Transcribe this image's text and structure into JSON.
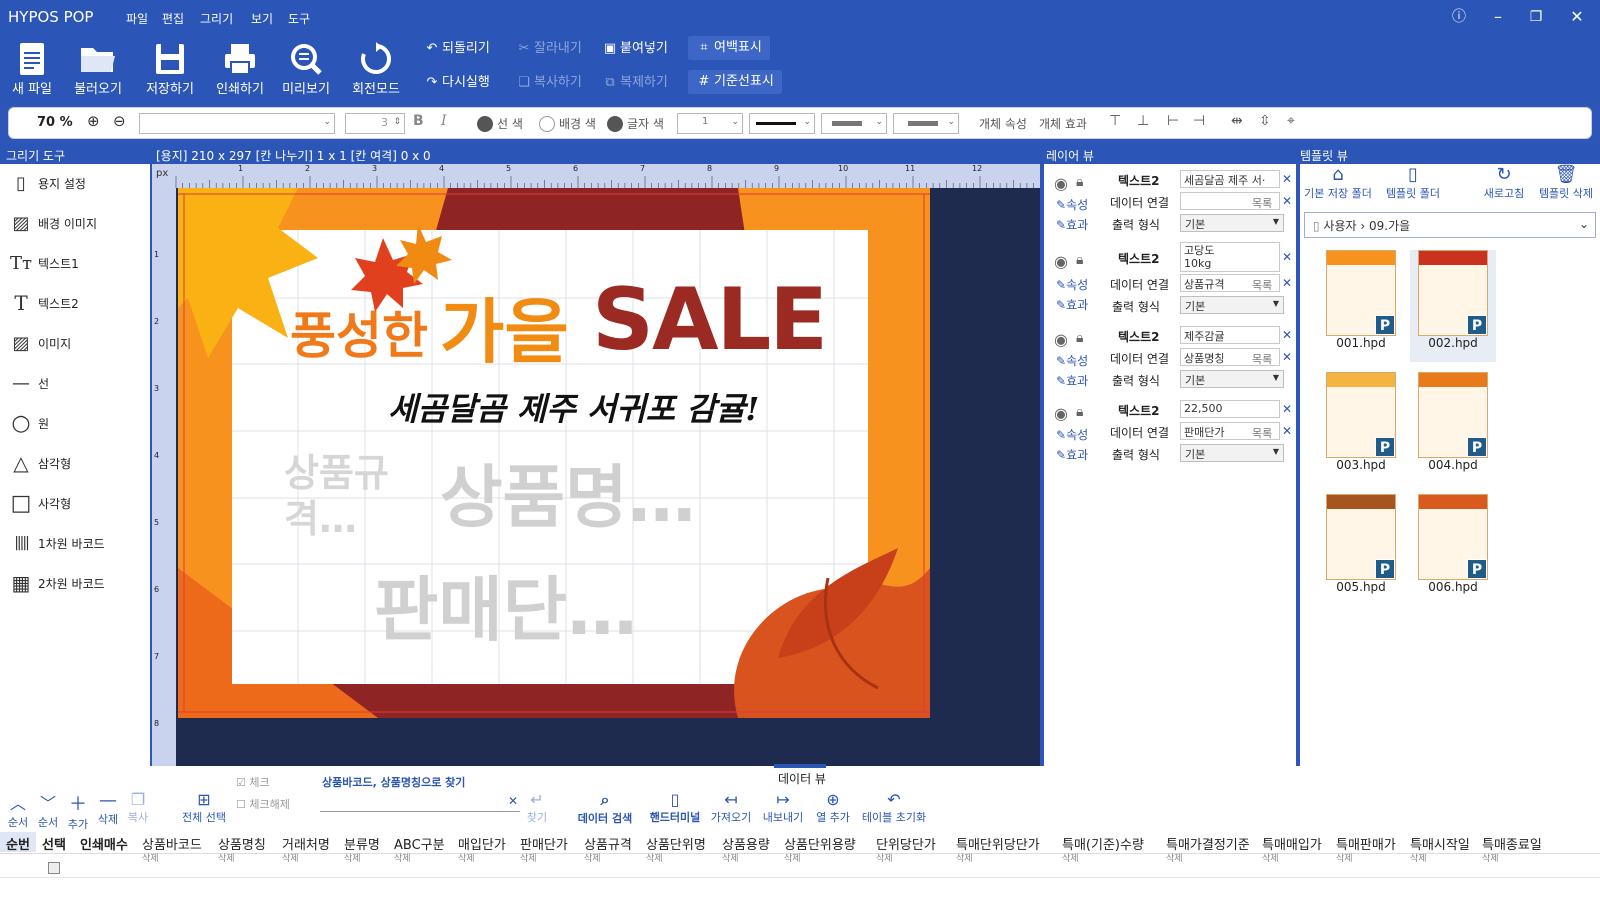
{
  "app": {
    "title": "HYPOS POP",
    "menus": [
      "파일",
      "편집",
      "그리기",
      "보기",
      "도구"
    ]
  },
  "ribbon": {
    "big": [
      {
        "label": "새 파일",
        "icon": "new-file-icon"
      },
      {
        "label": "불러오기",
        "icon": "folder-open-icon"
      },
      {
        "label": "저장하기",
        "icon": "save-icon"
      },
      {
        "label": "인쇄하기",
        "icon": "print-icon"
      },
      {
        "label": "미리보기",
        "icon": "preview-icon"
      },
      {
        "label": "회전모드",
        "icon": "rotate-icon"
      }
    ],
    "undo": "되돌리기",
    "redo": "다시실행",
    "cut": "잘라내기",
    "copy": "복사하기",
    "paste": "붙여넣기",
    "duplicate": "복제하기",
    "margin": "여백표시",
    "guides": "기준선표시"
  },
  "toolbar": {
    "zoom": "70 %",
    "font_size": "3",
    "line_color": "선 색",
    "bg_color": "배경 색",
    "text_color": "글자 색",
    "line_width": "1",
    "obj_props": "개체 속성",
    "obj_effect": "개체 효과"
  },
  "headers": {
    "tools": "그리기 도구",
    "paper": "[용지] 210 x 297  [칸 나누기] 1 x 1  [칸 여격] 0 x 0",
    "layer": "레이어 뷰",
    "template": "템플릿 뷰"
  },
  "tools": [
    "용지 설정",
    "배경 이미지",
    "텍스트1",
    "텍스트2",
    "이미지",
    "선",
    "원",
    "삼각형",
    "사각형",
    "1차원 바코드",
    "2차원 바코드"
  ],
  "ruler": {
    "unit": "px",
    "top": [
      "1",
      "2",
      "3",
      "4",
      "5",
      "6",
      "7",
      "8",
      "9",
      "10",
      "11",
      "12"
    ],
    "left": [
      "1",
      "2",
      "3",
      "4",
      "5",
      "6",
      "7",
      "8"
    ]
  },
  "poster": {
    "headline_a": "풍성한",
    "headline_b": "가을",
    "headline_c": "SALE",
    "subtitle": "세곰달곰 제주 서귀포 감귤!",
    "spec": "상품규격…",
    "name": "상품명…",
    "price": "판매단…"
  },
  "layers": [
    {
      "title": "텍스트2",
      "value": "세곰달곰 제주 서·",
      "link": "",
      "list": "목록",
      "format": "기본"
    },
    {
      "title": "텍스트2",
      "value": "고당도\n10kg",
      "link": "상품규격",
      "list": "목록",
      "format": "기본"
    },
    {
      "title": "텍스트2",
      "value": "제주감귤",
      "link": "상품명칭",
      "list": "목록",
      "format": "기본"
    },
    {
      "title": "텍스트2",
      "value": "22,500",
      "link": "판매단가",
      "list": "목록",
      "format": "기본"
    }
  ],
  "layer_labels": {
    "prop": "속성",
    "effect": "효과",
    "data_link": "데이터 연결",
    "out_format": "출력 형식"
  },
  "template": {
    "actions": [
      "기본 저장 폴더",
      "템플릿 폴더",
      "새로고침",
      "템플릿 삭제"
    ],
    "path_root": "사용자",
    "path_folder": "09.가을",
    "files": [
      "001.hpd",
      "002.hpd",
      "003.hpd",
      "004.hpd",
      "005.hpd",
      "006.hpd"
    ]
  },
  "dataview": {
    "title": "데이터 뷰",
    "buttons": [
      "순서",
      "순서",
      "추가",
      "삭제",
      "복사",
      "전체 선택",
      "체크",
      "체크해제",
      "찾기",
      "데이터 검색",
      "핸드터미널",
      "가져오기",
      "내보내기",
      "열 추가",
      "테이블 초기화"
    ],
    "search_placeholder": "상품바코드, 상품명칭으로 찾기",
    "columns": [
      "순번",
      "선택",
      "인쇄매수",
      "상품바코드",
      "상품명칭",
      "거래처명",
      "분류명",
      "ABC구분",
      "매입단가",
      "판매단가",
      "상품규격",
      "상품단위명",
      "상품용량",
      "상품단위용량",
      "단위당단가",
      "특매단위당단가",
      "특매(기준)수량",
      "특매가결정기준",
      "특매매입가",
      "특매판매가",
      "특매시작일",
      "특매종료일"
    ],
    "delete_label": "삭제"
  },
  "colors": {
    "accent": "#2b55b6",
    "canvas_bg": "#1e2b4f",
    "poster_red": "#8e2424",
    "poster_orange": "#f7921e"
  }
}
